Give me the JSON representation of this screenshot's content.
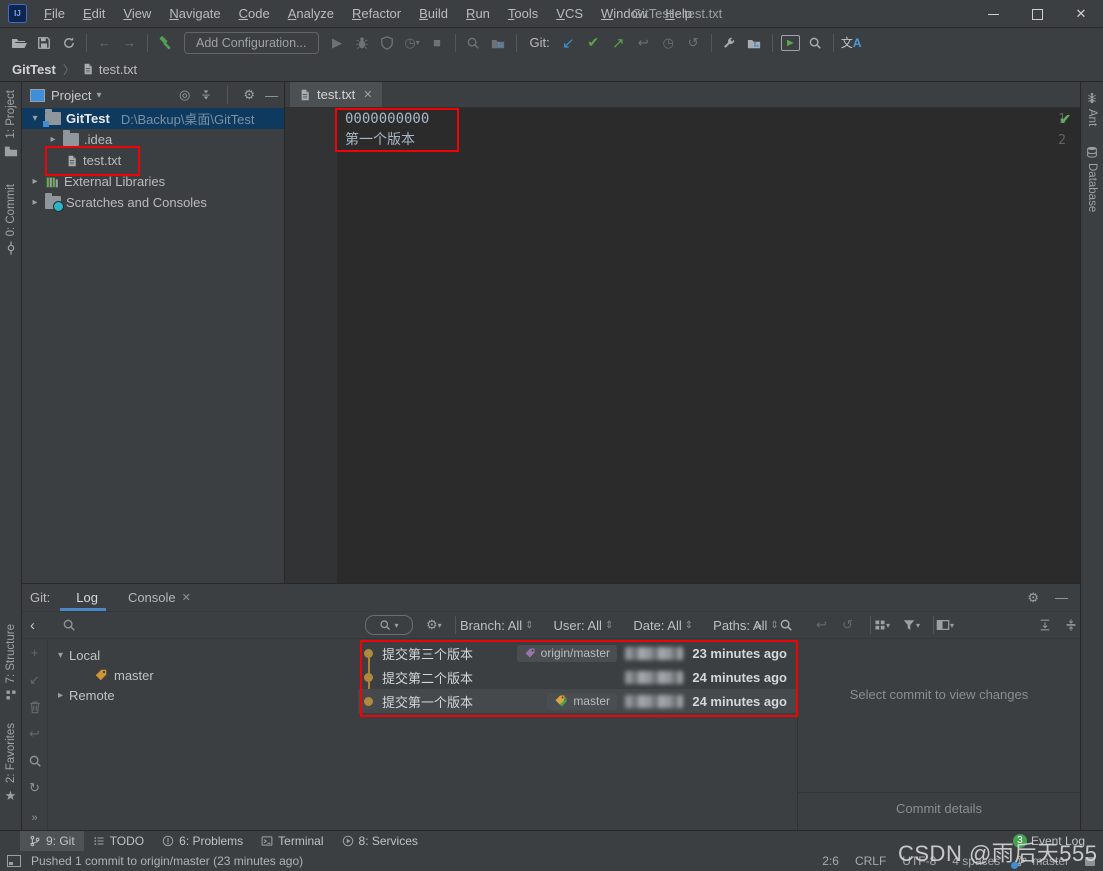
{
  "window": {
    "title": "GitTest - test.txt"
  },
  "menu": {
    "items": [
      "File",
      "Edit",
      "View",
      "Navigate",
      "Code",
      "Analyze",
      "Refactor",
      "Build",
      "Run",
      "Tools",
      "VCS",
      "Window",
      "Help"
    ]
  },
  "toolbar": {
    "run_config": "Add Configuration...",
    "git_label": "Git:"
  },
  "breadcrumb": {
    "project": "GitTest",
    "separator": "〉",
    "file": "test.txt"
  },
  "stripes": {
    "left_top": [
      "1: Project",
      "0: Commit"
    ],
    "left_bottom": [
      "7: Structure",
      "2: Favorites"
    ],
    "right": [
      "Ant",
      "Database"
    ]
  },
  "project_panel": {
    "title": "Project",
    "root_name": "GitTest",
    "root_path": "D:\\Backup\\桌面\\GitTest",
    "items": [
      ".idea",
      "test.txt",
      "External Libraries",
      "Scratches and Consoles"
    ]
  },
  "editor": {
    "tab": "test.txt",
    "lines": [
      {
        "num": "1",
        "text": "0000000000"
      },
      {
        "num": "2",
        "text": "第一个版本"
      }
    ]
  },
  "git": {
    "label": "Git:",
    "tab_log": "Log",
    "tab_console": "Console",
    "filters": {
      "branch": "Branch: All",
      "user": "User: All",
      "date": "Date: All",
      "paths": "Paths: All"
    },
    "branches": {
      "local": "Local",
      "local_branch": "master",
      "remote": "Remote"
    },
    "commits": [
      {
        "message": "提交第三个版本",
        "ref": "origin/master",
        "time": "23 minutes ago"
      },
      {
        "message": "提交第二个版本",
        "ref": "",
        "time": "24 minutes ago"
      },
      {
        "message": "提交第一个版本",
        "ref": "master",
        "time": "24 minutes ago"
      }
    ],
    "details_placeholder": "Select commit to view changes",
    "details_title": "Commit details"
  },
  "toolwindows": {
    "items": [
      "9: Git",
      "TODO",
      "6: Problems",
      "Terminal",
      "8: Services"
    ],
    "event_log": "Event Log",
    "event_badge": "3"
  },
  "status": {
    "message": "Pushed 1 commit to origin/master (23 minutes ago)",
    "caret": "2:6",
    "line_sep": "CRLF",
    "encoding": "UTF-8",
    "indent": "4 spaces",
    "branch": "master"
  },
  "watermark": "CSDN @雨后天555",
  "icons": {
    "close": "✕",
    "back": "←",
    "forward": "→",
    "run": "▶",
    "stop": "■",
    "update": "↙",
    "commit": "✔",
    "push": "↗",
    "cherry": "↩",
    "history": "◷",
    "rollback": "↺",
    "gear": "⚙",
    "chevron_down": "▾",
    "chevron_right": "▸",
    "collapse_left": "‹",
    "double_chevron": "»",
    "expand_all": "⇞",
    "collapse_all": "⇟",
    "plus": "+",
    "refresh": "↻",
    "star": "★",
    "target": "◎",
    "minus": "—",
    "updown": "⇕",
    "translate_cn": "文",
    "translate_a": "A",
    "check_ok": "✔"
  },
  "colors": {
    "accent_blue": "#4a88c7",
    "git_green": "#57a64a",
    "git_blue": "#3b8fd6",
    "tag_gold": "#cf9733",
    "tag_purple": "#9876aa",
    "annotation_red": "#f00307",
    "selection_blue": "#0d3a5e"
  }
}
